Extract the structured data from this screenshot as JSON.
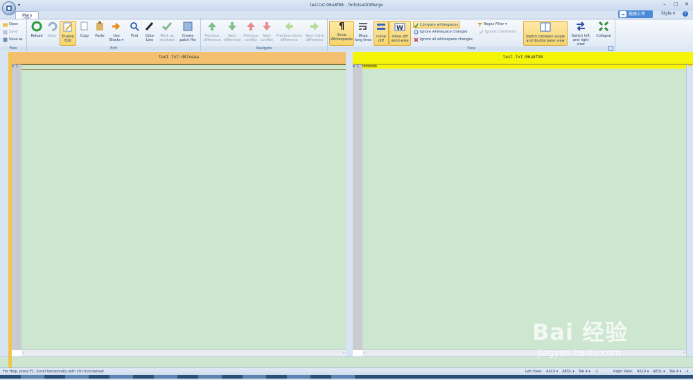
{
  "window": {
    "title": "test.txt:06a8f98 - TortoiseGitMerge",
    "minimize": "–",
    "maximize": "□",
    "close": "✕"
  },
  "tabs": {
    "main_label": "Main",
    "main_key": "M"
  },
  "top_right": {
    "upload_label": "拖拽上传",
    "style_label": "Style ▾",
    "help": "?"
  },
  "ribbon": {
    "files": {
      "label": "Files",
      "items": [
        {
          "label": "Open",
          "icon": "folder-open-icon"
        },
        {
          "label": "Save",
          "icon": "save-icon"
        },
        {
          "label": "Save as",
          "icon": "save-as-icon"
        }
      ]
    },
    "edit": {
      "label": "Edit",
      "reload": "Reload",
      "undo": "Undo",
      "enable_edit": "Enable\nEdit",
      "copy": "Copy",
      "paste": "Paste",
      "use_blocks": "Use\nBlocks ▾",
      "find": "Find",
      "goto_line": "Goto\nLine",
      "mark_resolved": "Mark as\nresolved",
      "create_patch": "Create\npatch file"
    },
    "navigate": {
      "label": "Navigate",
      "prev_diff": "Previous\ndifference",
      "next_diff": "Next\ndifference",
      "prev_conflict": "Previous\nconflict",
      "next_conflict": "Next\nconflict",
      "prev_inline": "Previous inline\ndifference",
      "next_inline": "Next inline\ndifference"
    },
    "view": {
      "label": "View",
      "show_ws": "Show\nWhitespaces",
      "wrap": "Wrap\nlong lines",
      "inline_diff": "Inline\ndiff",
      "inline_word": "Inline diff\nword-wise",
      "compare_ws": "Compare whitespaces",
      "ignore_ws_changes": "Ignore whitespace changes",
      "ignore_all_ws": "Ignore all whitespace changes",
      "regex_filter": "Regex Filter ▾",
      "ignore_comments": "Ignore Comments",
      "switch_pane": "Switch between single\nand double pane view",
      "switch_lr": "Switch left\nand right view",
      "collapse": "Collapse"
    }
  },
  "left_pane": {
    "header": "test.txt:d47ceaa",
    "line_no": "1",
    "line_marker": "⊖",
    "content": ""
  },
  "right_pane": {
    "header": "test.txt:06a8f98",
    "line_no": "1",
    "line_marker": "⊕",
    "content": "bbbbbbb"
  },
  "scroll": {
    "left_arrow": "‹",
    "right_arrow": "›"
  },
  "status": {
    "help": "For Help, press F1. Scroll horizontally with Ctrl-Scrollwheel",
    "left_view_label": "Left View:",
    "left_enc": "ASCII ▾",
    "left_eol": "AEOL ▾",
    "left_tab": "Tab 4 ▾",
    "left_count": "-1",
    "right_view_label": "Right View:",
    "right_enc": "ASCII ▾",
    "right_eol": "AEOL ▾",
    "right_tab": "Tab 4 ▾",
    "right_count": "-1"
  },
  "watermark": {
    "brand": "Bai 经验",
    "url": "jingyan.baidu.com"
  },
  "colors": {
    "left_header": "#f3c070",
    "right_header": "#f5f50a",
    "diff_bg": "#cde6cf",
    "accent": "#4a8ad6"
  }
}
